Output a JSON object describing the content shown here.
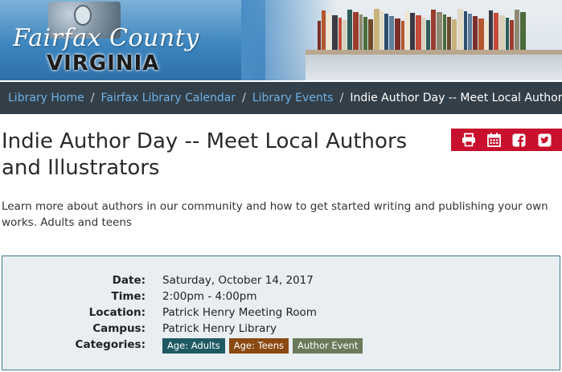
{
  "header": {
    "logo_line1": "Fairfax County",
    "logo_line2": "VIRGINIA"
  },
  "breadcrumb": [
    {
      "label": "Library Home"
    },
    {
      "label": "Fairfax Library Calendar"
    },
    {
      "label": "Library Events"
    },
    {
      "label": "Indie Author Day -- Meet Local Authors and Illustrators"
    }
  ],
  "breadcrumb_separator": "/",
  "event": {
    "title": "Indie Author Day -- Meet Local Authors and Illustrators",
    "description": "Learn more about authors in our community and how to get started writing and publishing your own works. Adults and teens"
  },
  "share_icons": [
    "print-icon",
    "calendar-icon",
    "facebook-icon",
    "twitter-icon"
  ],
  "details": {
    "date_label": "Date:",
    "date": "Saturday, October 14, 2017",
    "time_label": "Time:",
    "time": "2:00pm - 4:00pm",
    "location_label": "Location:",
    "location": "Patrick Henry Meeting Room",
    "campus_label": "Campus:",
    "campus": "Patrick Henry Library",
    "categories_label": "Categories:",
    "categories": [
      {
        "label": "Age: Adults",
        "color": "#1f5a63"
      },
      {
        "label": "Age: Teens",
        "color": "#8a4a12"
      },
      {
        "label": "Author Event",
        "color": "#6b7a5a"
      }
    ]
  },
  "colors": {
    "breadcrumb_bg": "#333f48",
    "link": "#6fb1e6",
    "share_bg": "#c8102e",
    "details_bg": "#e9eef1",
    "details_border": "#3c7d8c"
  }
}
